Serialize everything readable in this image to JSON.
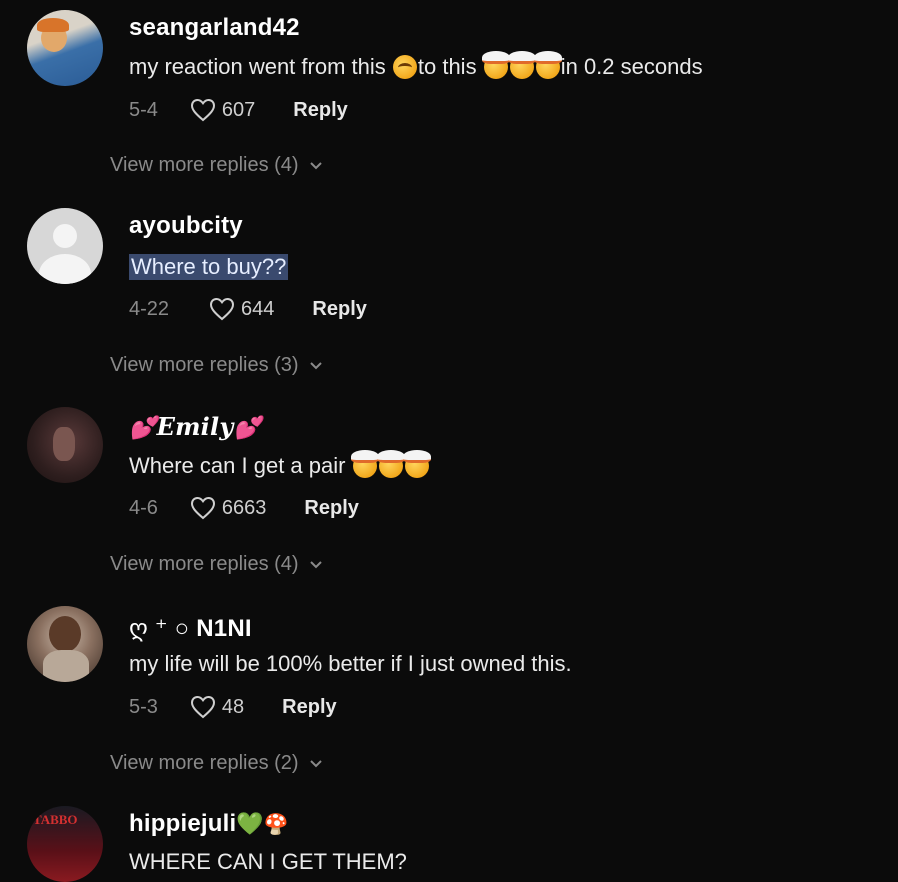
{
  "comments": [
    {
      "username": "seangarland42",
      "text_parts": [
        "my reaction went from this",
        "to this",
        "in 0.2 seconds"
      ],
      "date": "5-4",
      "likes": "607",
      "reply_label": "Reply",
      "more_replies": "View more replies (4)"
    },
    {
      "username": "ayoubcity",
      "text": "Where to buy??",
      "date": "4-22",
      "likes": "644",
      "reply_label": "Reply",
      "more_replies": "View more replies (3)"
    },
    {
      "username": "Emily",
      "text": "Where can I get a pair",
      "date": "4-6",
      "likes": "6663",
      "reply_label": "Reply",
      "more_replies": "View more replies (4)"
    },
    {
      "username_prefix": "ღ ⁺ ○",
      "username": "N1NI",
      "text": "my life will be 100% better if I just owned this.",
      "date": "5-3",
      "likes": "48",
      "reply_label": "Reply",
      "more_replies": "View more replies (2)"
    },
    {
      "username": "hippiejuli",
      "text": "WHERE CAN I GET THEM?",
      "avatar_text": "TABBO"
    }
  ],
  "icons": {
    "like": "heart-outline-icon",
    "expand": "chevron-down-icon",
    "emoji_mind_blown": "exploding-head-emoji",
    "emoji_flushed": "flushed-face-emoji"
  },
  "colors": {
    "background": "#0b0b0b",
    "username": "#ffffff",
    "meta": "#8a8a8a",
    "selection": "#3a4a6e"
  }
}
